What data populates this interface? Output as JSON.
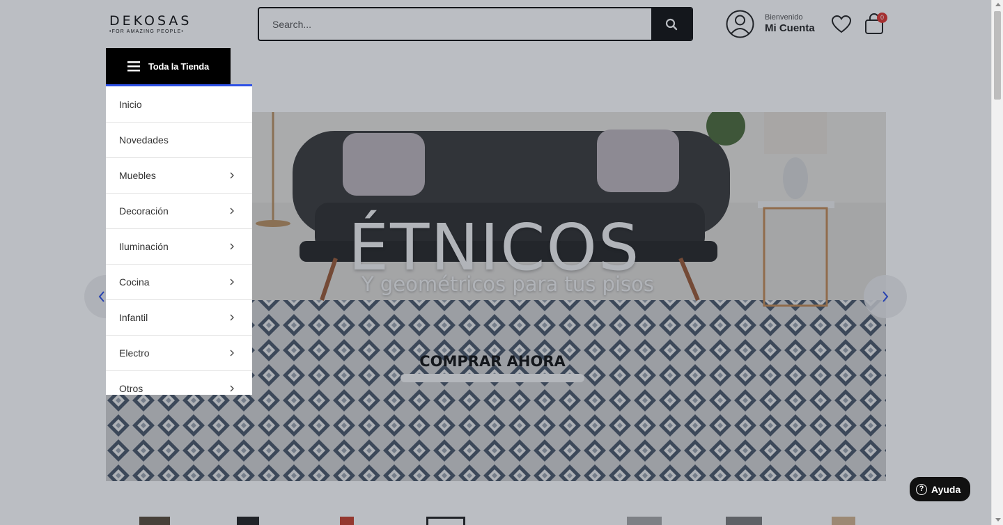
{
  "header": {
    "logo": {
      "brand": "DEKOSAS",
      "tagline": "•FOR AMAZING PEOPLE•"
    },
    "search": {
      "placeholder": "Search...",
      "value": ""
    },
    "account": {
      "greeting": "Bienvenido",
      "label": "Mi Cuenta",
      "icon": "user-circle-icon"
    },
    "wishlist": {
      "icon": "heart-icon"
    },
    "cart": {
      "icon": "bag-icon",
      "count": "0",
      "badge_color": "#e0342f"
    }
  },
  "store_menu": {
    "button_label": "Toda la Tienda",
    "accent_color": "#2d50e6",
    "items": [
      {
        "label": "Inicio",
        "has_submenu": false
      },
      {
        "label": "Novedades",
        "has_submenu": false
      },
      {
        "label": "Muebles",
        "has_submenu": true
      },
      {
        "label": "Decoración",
        "has_submenu": true
      },
      {
        "label": "Iluminación",
        "has_submenu": true
      },
      {
        "label": "Cocina",
        "has_submenu": true
      },
      {
        "label": "Infantil",
        "has_submenu": true
      },
      {
        "label": "Electro",
        "has_submenu": true
      },
      {
        "label": "Otros",
        "has_submenu": true
      }
    ]
  },
  "hero": {
    "title": "ÉTNICOS",
    "subtitle": "Y geométricos para tus pisos",
    "cta": "COMPRAR AHORA",
    "arrow_color": "#2d50e6"
  },
  "help": {
    "label": "Ayuda"
  }
}
